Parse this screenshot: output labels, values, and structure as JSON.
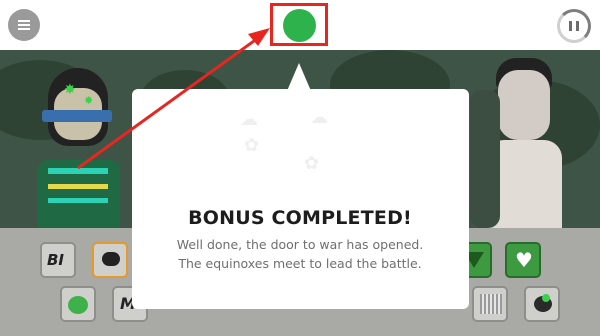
{
  "popup": {
    "title": "BONUS COMPLETED!",
    "line1": "Well done, the door to war has opened.",
    "line2": "The equinoxes meet to lead the battle."
  },
  "tray": {
    "slot_row1_label": "BI",
    "slot_row2_label": "M"
  },
  "colors": {
    "accent_green": "#2eb24b",
    "annotation_red": "#e8261f"
  },
  "icons": [
    "menu-icon",
    "pause-icon"
  ]
}
